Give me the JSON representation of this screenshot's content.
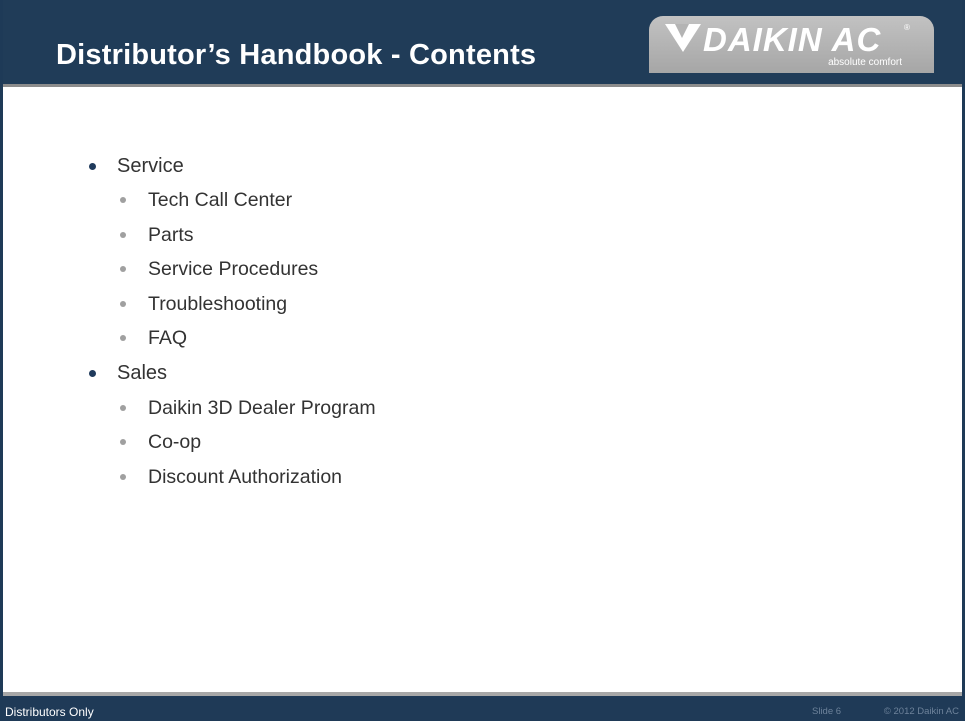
{
  "slide": {
    "title": "Distributor’s Handbook - Contents",
    "logo": {
      "brand": "DAIKIN AC",
      "registered": "®",
      "tagline": "absolute comfort"
    },
    "outline": [
      {
        "level": 1,
        "text": "Service"
      },
      {
        "level": 2,
        "text": "Tech Call Center"
      },
      {
        "level": 2,
        "text": "Parts"
      },
      {
        "level": 2,
        "text": "Service Procedures"
      },
      {
        "level": 2,
        "text": "Troubleshooting"
      },
      {
        "level": 2,
        "text": "FAQ"
      },
      {
        "level": 1,
        "text": "Sales"
      },
      {
        "level": 2,
        "text": "Daikin 3D Dealer Program"
      },
      {
        "level": 2,
        "text": "Co-op"
      },
      {
        "level": 2,
        "text": "Discount Authorization"
      }
    ],
    "footer": {
      "left": "Distributors Only",
      "slide_number": "Slide 6",
      "copyright": "© 2012 Daikin AC"
    }
  },
  "colors": {
    "header_bg": "#203c58",
    "accent_bullet": "#1f3a5c",
    "sub_bullet": "#a0a0a0",
    "logo_bg": "#b4b4b4"
  }
}
